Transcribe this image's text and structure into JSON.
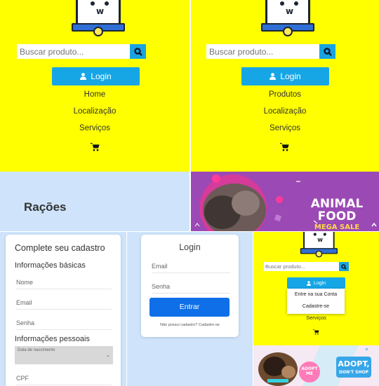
{
  "panel1": {
    "search_placeholder": "Buscar produto...",
    "login_label": "Login",
    "nav": [
      "Home",
      "Localização",
      "Serviços"
    ],
    "section_title": "Rações"
  },
  "panel2": {
    "search_placeholder": "Buscar produto...",
    "login_label": "Login",
    "nav": [
      "Produtos",
      "Localização",
      "Serviços"
    ],
    "banner": {
      "line1": "ANIMAL",
      "line2": "FOOD",
      "line3": "MEGA SALE"
    }
  },
  "register": {
    "title": "Complete seu cadastro",
    "basic_info": "Informações básicas",
    "name_ph": "Nome",
    "email_ph": "Email",
    "password_ph": "Senha",
    "personal_info": "Informações pessoais",
    "birthdate": "Data de nascimento",
    "cpf_ph": "CPF"
  },
  "login": {
    "title": "Login",
    "email_ph": "Email",
    "password_ph": "Senha",
    "submit": "Entrar",
    "footer": "Não possui cadastro? Cadastre-se"
  },
  "panel5": {
    "search_placeholder": "Buscar produto...",
    "login_label": "Login",
    "dropdown": [
      "Entre na sua Conta",
      "Cadastre-se"
    ],
    "nav_services": "Serviços",
    "banner": {
      "adopt_me": "ADOPT ME",
      "adopt": "ADOPT,",
      "dont_shop": "DON'T SHOP"
    }
  },
  "colors": {
    "yellow": "#ffff00",
    "light_blue": "#cfe4fb",
    "accent_blue": "#16a6e6",
    "primary_button": "#0e6fe8"
  }
}
